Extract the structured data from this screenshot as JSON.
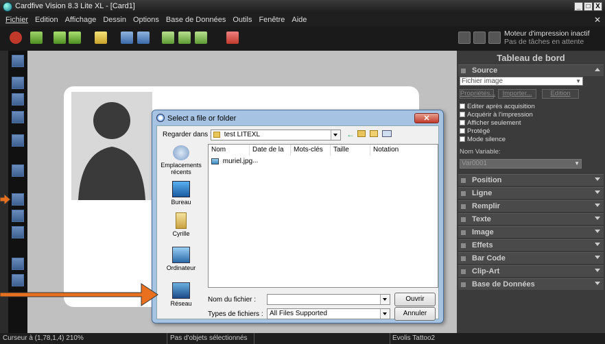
{
  "window": {
    "title": "Cardfive Vision 8.3 Lite XL - [Card1]",
    "controls": [
      "_",
      "□",
      "X"
    ]
  },
  "menu": [
    "Fichier",
    "Edition",
    "Affichage",
    "Dessin",
    "Options",
    "Base de Données",
    "Outils",
    "Fenêtre",
    "Aide"
  ],
  "print_status": {
    "line1": "Moteur d'impression inactif",
    "line2": "Pas de tâches en attente"
  },
  "panel": {
    "title": "Tableau de bord",
    "source": {
      "label": "Source",
      "type_value": "Fichier image",
      "buttons": [
        "Propriétés...",
        "Importer...",
        "Edition"
      ],
      "checkboxes": [
        "Editer après acquisition",
        "Acquérir à l'impression",
        "Afficher seulement",
        "Protégé",
        "Mode silence"
      ],
      "variable_label": "Nom Variable:",
      "variable_value": "Var0001"
    },
    "sections": [
      "Position",
      "Ligne",
      "Remplir",
      "Texte",
      "Image",
      "Effets",
      "Bar Code",
      "Clip-Art",
      "Base de Données"
    ]
  },
  "status": {
    "cursor": "Curseur à (1,78,1,4) 210%",
    "selection": "Pas d'objets sélectionnés",
    "printer": "Evolis Tattoo2"
  },
  "dialog": {
    "title": "Select a file or folder",
    "look_in_label": "Regarder dans :",
    "look_in_value": "test LITEXL",
    "places": [
      "Emplacements récents",
      "Bureau",
      "Cyrille",
      "Ordinateur",
      "Réseau"
    ],
    "columns": [
      "Nom",
      "Date de la ...",
      "Mots-clés",
      "Taille",
      "Notation"
    ],
    "files": [
      "muriel.jpg"
    ],
    "filename_label": "Nom du fichier :",
    "filename_value": "",
    "filetype_label": "Types de fichiers :",
    "filetype_value": "All Files Supported",
    "open_button": "Ouvrir",
    "cancel_button": "Annuler"
  },
  "colors": {
    "accent_arrow": "#e8701e",
    "panel_bg": "#3b3b3b",
    "canvas_bg": "#c0c0c0"
  }
}
